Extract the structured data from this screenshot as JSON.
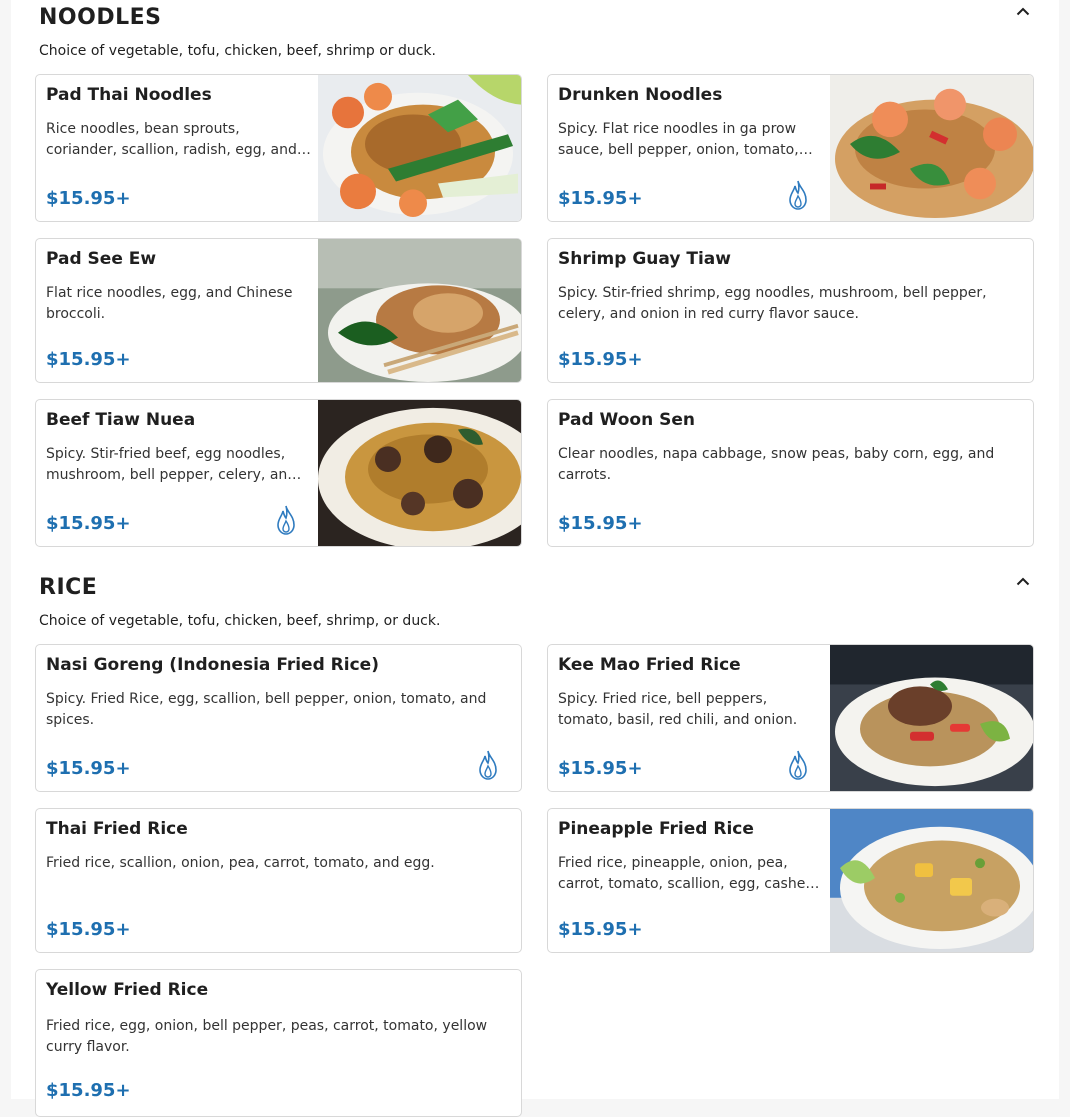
{
  "sections": {
    "noodles": {
      "title": "NOODLES",
      "description": "Choice of vegetable, tofu, chicken, beef, shrimp or duck.",
      "collapse_icon": "chevron-up-icon",
      "items": [
        {
          "name": "Pad Thai Noodles",
          "description": "Rice noodles, bean sprouts, coriander, scallion, radish, egg, and crushed peanuts.",
          "price": "$15.95+",
          "spicy": false,
          "has_photo": true
        },
        {
          "name": "Drunken Noodles",
          "description": "Spicy. Flat rice noodles in ga prow sauce, bell pepper, onion, tomato, and basil.",
          "price": "$15.95+",
          "spicy": true,
          "has_photo": true
        },
        {
          "name": "Pad See Ew",
          "description": "Flat rice noodles, egg, and Chinese broccoli.",
          "price": "$15.95+",
          "spicy": false,
          "has_photo": true
        },
        {
          "name": "Shrimp Guay Tiaw",
          "description": "Spicy. Stir-fried shrimp, egg noodles, mushroom, bell pepper, celery, and onion in red curry flavor sauce.",
          "price": "$15.95+",
          "spicy": false,
          "has_photo": false
        },
        {
          "name": "Beef Tiaw Nuea",
          "description": "Spicy. Stir-fried beef, egg noodles, mushroom, bell pepper, celery, and onion.",
          "price": "$15.95+",
          "spicy": true,
          "has_photo": true
        },
        {
          "name": "Pad Woon Sen",
          "description": "Clear noodles, napa cabbage, snow peas, baby corn, egg, and carrots.",
          "price": "$15.95+",
          "spicy": false,
          "has_photo": false
        }
      ]
    },
    "rice": {
      "title": "RICE",
      "description": "Choice of vegetable, tofu, chicken, beef, shrimp, or duck.",
      "collapse_icon": "chevron-up-icon",
      "items": [
        {
          "name": "Nasi Goreng (Indonesia Fried Rice)",
          "description": "Spicy. Fried Rice, egg, scallion, bell pepper, onion, tomato, and spices.",
          "price": "$15.95+",
          "spicy": true,
          "has_photo": false
        },
        {
          "name": "Kee Mao Fried Rice",
          "description": "Spicy. Fried rice, bell peppers, tomato, basil, red chili, and onion.",
          "price": "$15.95+",
          "spicy": true,
          "has_photo": true
        },
        {
          "name": "Thai Fried Rice",
          "description": "Fried rice, scallion, onion, pea, carrot, tomato, and egg.",
          "price": "$15.95+",
          "spicy": false,
          "has_photo": false
        },
        {
          "name": "Pineapple Fried Rice",
          "description": "Fried rice, pineapple, onion, pea, carrot, tomato, scallion, egg, cashew nuts.",
          "price": "$15.95+",
          "spicy": false,
          "has_photo": true
        },
        {
          "name": "Yellow Fried Rice",
          "description": "Fried rice, egg, onion, bell pepper, peas, carrot, tomato, yellow curry flavor.",
          "price": "$15.95+",
          "spicy": false,
          "has_photo": false
        }
      ]
    }
  },
  "icons": {
    "spicy": "flame-icon",
    "collapse": "chevron-up-icon",
    "photo": "food-photo"
  },
  "colors": {
    "price": "#1e6fb0",
    "spicy_icon": "#2f7bbf",
    "card_border": "#d8d8d8"
  }
}
